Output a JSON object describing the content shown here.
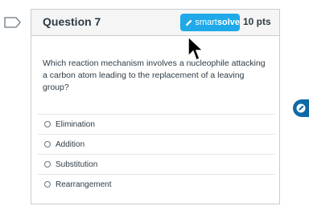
{
  "question": {
    "title": "Question 7",
    "points": "10 pts",
    "text": "Which reaction mechanism involves a nucleophile attacking a carbon atom leading to the replacement of a leaving group?"
  },
  "smartsolve": {
    "label_light": "smart",
    "label_bold": "solve",
    "icon": "pen-icon",
    "color": "#1fa9e8"
  },
  "answers": [
    {
      "label": "Elimination"
    },
    {
      "label": "Addition"
    },
    {
      "label": "Substitution"
    },
    {
      "label": "Rearrangement"
    }
  ],
  "side_tab": {
    "icon": "smartsolve-icon",
    "color": "#0e6aa6"
  }
}
